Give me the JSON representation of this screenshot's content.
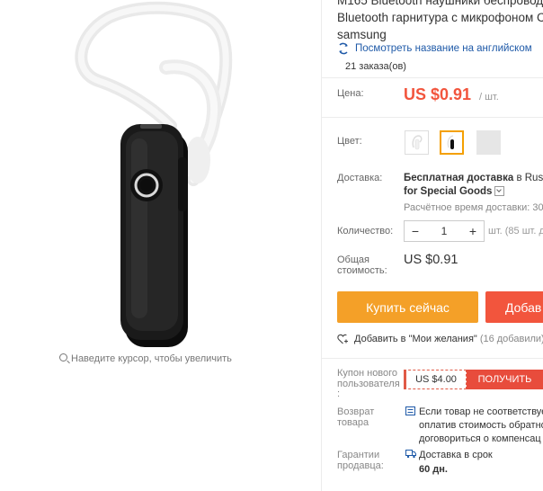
{
  "product": {
    "title_lines": [
      "M165 Bluetooth наушники беспроводн",
      "Bluetooth гарнитура с микрофоном C",
      "samsung"
    ],
    "translate_link": "Посмотреть название на английском",
    "orders": "21 заказа(ов)"
  },
  "image": {
    "zoom_hint": "Наведите курсор, чтобы увеличить"
  },
  "price": {
    "label": "Цена:",
    "value": "US $0.91",
    "unit": "/ шт."
  },
  "color": {
    "label": "Цвет:",
    "options": [
      "white-earpiece",
      "black-earpiece",
      "gray"
    ],
    "selected_index": 1
  },
  "shipping": {
    "label": "Доставка:",
    "main_bold": "Бесплатная доставка",
    "main_rest": " в Russia",
    "sub": "for Special Goods",
    "estimate": "Расчётное время доставки: 30-"
  },
  "quantity": {
    "label": "Количество:",
    "value": "1",
    "minus": "−",
    "plus": "+",
    "available": "шт. (85 шт. д"
  },
  "total": {
    "label_line1": "Общая",
    "label_line2": "стоимость:",
    "value": "US $0.91"
  },
  "buttons": {
    "buy_now": "Купить сейчас",
    "add_to_cart": "Добав"
  },
  "wishlist": {
    "label": "Добавить в \"Мои желания\"",
    "count": "(16 добавили)"
  },
  "coupon": {
    "label_line1": "Купон нового",
    "label_line2": "пользователя",
    "label_line3": ":",
    "value": "US $4.00",
    "get": "ПОЛУЧИТЬ"
  },
  "returns": {
    "label_line1": "Возврат",
    "label_line2": "товара",
    "text_line1": "Если товар не соответствуе",
    "text_line2": "оплатив стоимость обратно",
    "text_line3": "договориться о компенсац"
  },
  "guarantee": {
    "label_line1": "Гарантии",
    "label_line2": "продавца:",
    "text_line1": "Доставка в срок",
    "text_line2": "60 дн."
  },
  "colors": {
    "price_red": "#f2553d",
    "buy_orange": "#f4a028",
    "cart_red": "#f2553d",
    "link_blue": "#1f5aa8",
    "swatch_selected": "#f4a000"
  }
}
